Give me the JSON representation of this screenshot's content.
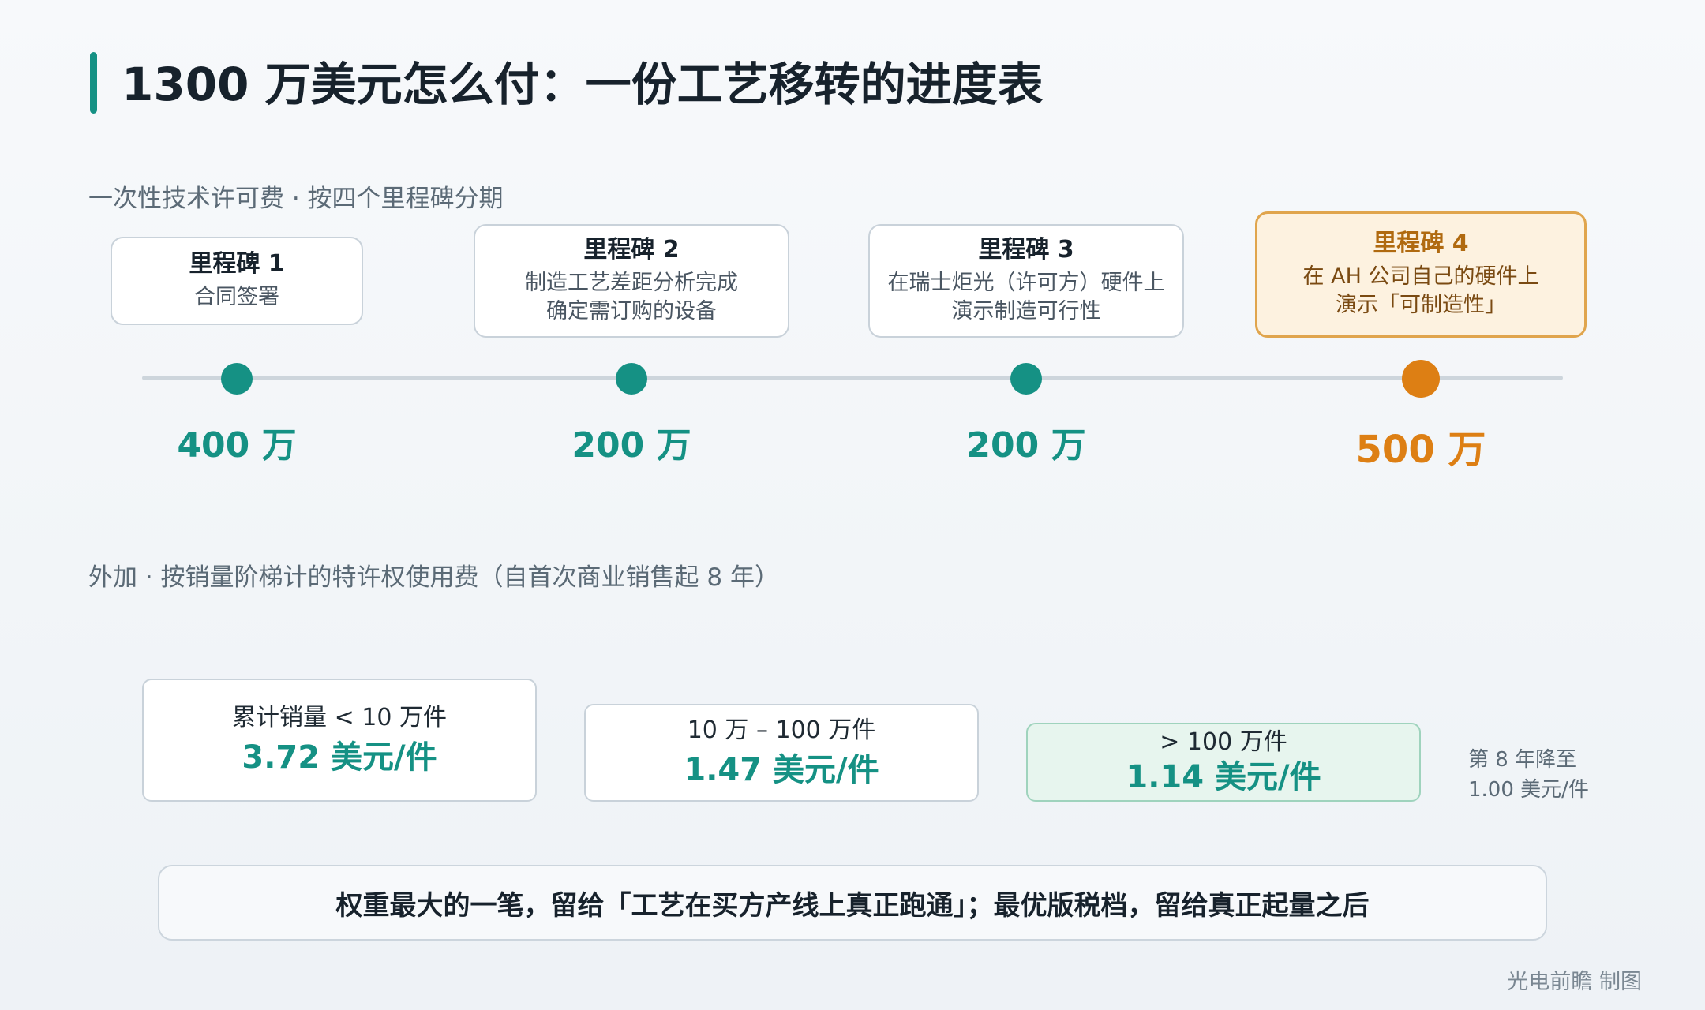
{
  "title": "1300 万美元怎么付：一份工艺移转的进度表",
  "section1_label": "一次性技术许可费 · 按四个里程碑分期",
  "milestones": [
    {
      "title": "里程碑 1",
      "desc_line1": "合同签署",
      "desc_line2": "",
      "amount": "400 万"
    },
    {
      "title": "里程碑 2",
      "desc_line1": "制造工艺差距分析完成",
      "desc_line2": "确定需订购的设备",
      "amount": "200 万"
    },
    {
      "title": "里程碑 3",
      "desc_line1": "在瑞士炬光（许可方）硬件上",
      "desc_line2": "演示制造可行性",
      "amount": "200 万"
    },
    {
      "title": "里程碑 4",
      "desc_line1": "在 AH 公司自己的硬件上",
      "desc_line2": "演示「可制造性」",
      "amount": "500 万"
    }
  ],
  "section2_label": "外加 · 按销量阶梯计的特许权使用费（自首次商业销售起 8 年）",
  "tiers": [
    {
      "label": "累计销量 < 10 万件",
      "rate": "3.72 美元/件"
    },
    {
      "label": "10 万 – 100 万件",
      "rate": "1.47 美元/件"
    },
    {
      "label": "> 100 万件",
      "rate": "1.14 美元/件"
    }
  ],
  "tier_note_line1": "第 8 年降至",
  "tier_note_line2": "1.00 美元/件",
  "summary": "权重最大的一笔，留给「工艺在买方产线上真正跑通」；最优版税档，留给真正起量之后",
  "credit": "光电前瞻 制图",
  "colors": {
    "accent": "#159184",
    "highlight": "#dd7f14",
    "highlight_bg": "#fdf2e0",
    "top_tier_bg": "#e7f5ee"
  }
}
